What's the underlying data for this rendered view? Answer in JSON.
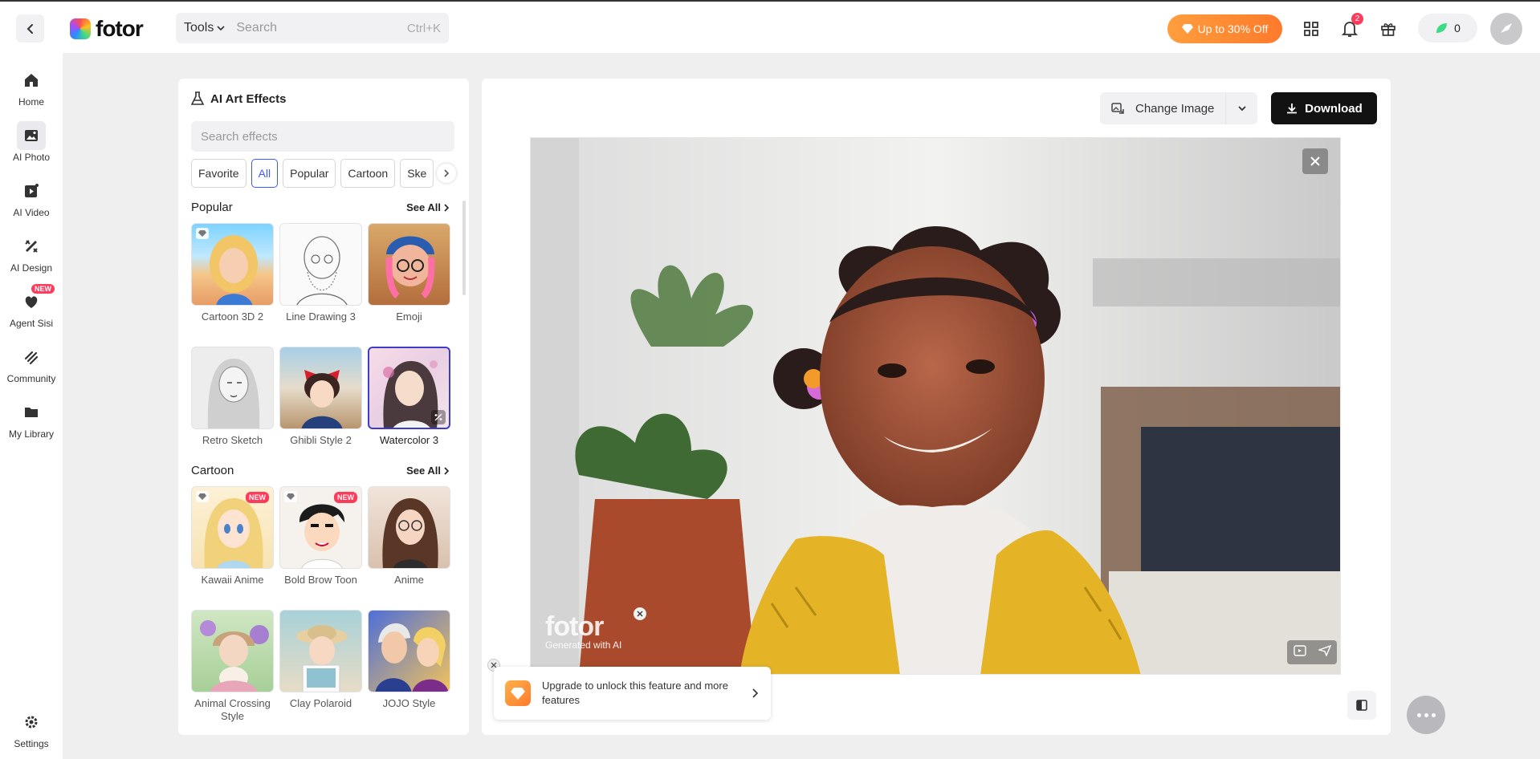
{
  "topbar": {
    "brand": "fotor",
    "tools_label": "Tools",
    "search_placeholder": "Search",
    "search_shortcut": "Ctrl+K",
    "promo_label": "Up to 30% Off",
    "notification_count": "2",
    "credits": "0"
  },
  "sidebar": {
    "items": [
      {
        "label": "Home",
        "icon": "home-icon"
      },
      {
        "label": "AI Photo",
        "icon": "ai-photo-icon",
        "active": true
      },
      {
        "label": "AI Video",
        "icon": "ai-video-icon"
      },
      {
        "label": "AI Design",
        "icon": "ai-design-icon"
      },
      {
        "label": "Agent Sisi",
        "icon": "agent-icon",
        "badge": "NEW"
      },
      {
        "label": "Community",
        "icon": "community-icon"
      },
      {
        "label": "My Library",
        "icon": "folder-icon"
      }
    ],
    "settings_label": "Settings"
  },
  "effects_panel": {
    "title": "AI Art Effects",
    "search_placeholder": "Search effects",
    "chips": [
      "Favorite",
      "All",
      "Popular",
      "Cartoon",
      "Ske"
    ],
    "active_chip": "All",
    "sections": [
      {
        "title": "Popular",
        "see_all": "See All",
        "cards": [
          {
            "label": "Cartoon 3D 2",
            "pro": true
          },
          {
            "label": "Line Drawing 3"
          },
          {
            "label": "Emoji"
          },
          {
            "label": "Retro Sketch"
          },
          {
            "label": "Ghibli Style 2"
          },
          {
            "label": "Watercolor 3",
            "selected": true
          }
        ]
      },
      {
        "title": "Cartoon",
        "see_all": "See All",
        "cards": [
          {
            "label": "Kawaii Anime",
            "pro": true,
            "badge": "NEW"
          },
          {
            "label": "Bold Brow Toon",
            "pro": true,
            "badge": "NEW"
          },
          {
            "label": "Anime"
          },
          {
            "label": "Animal Crossing Style"
          },
          {
            "label": "Clay Polaroid"
          },
          {
            "label": "JOJO Style"
          }
        ]
      }
    ]
  },
  "editor": {
    "change_image_label": "Change Image",
    "download_label": "Download",
    "watermark_brand": "fotor",
    "watermark_sub": "Generated with AI",
    "upgrade_text": "Upgrade to unlock this feature and more features"
  },
  "colors": {
    "accent": "#3d5afe",
    "promo": "#ff8a33",
    "badge": "#ff3b5c",
    "download_bg": "#121212"
  }
}
